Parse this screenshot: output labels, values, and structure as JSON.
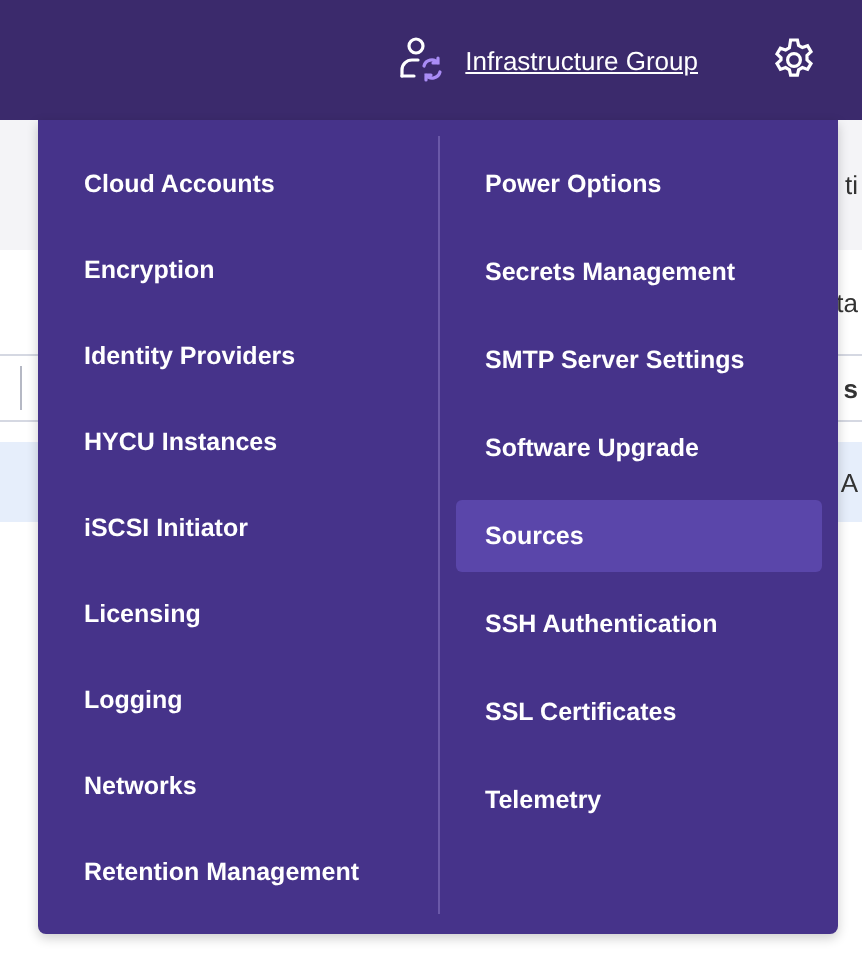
{
  "header": {
    "group_link": "Infrastructure Group"
  },
  "background": {
    "toolbar_text": "ti",
    "row_text": "ta",
    "column_header": "s",
    "selected_row_text": "A"
  },
  "settings_menu": {
    "columns": [
      [
        {
          "label": "Cloud Accounts",
          "selected": false
        },
        {
          "label": "Encryption",
          "selected": false
        },
        {
          "label": "Identity Providers",
          "selected": false
        },
        {
          "label": "HYCU Instances",
          "selected": false
        },
        {
          "label": "iSCSI Initiator",
          "selected": false
        },
        {
          "label": "Licensing",
          "selected": false
        },
        {
          "label": "Logging",
          "selected": false
        },
        {
          "label": "Networks",
          "selected": false
        },
        {
          "label": "Retention Management",
          "selected": false
        }
      ],
      [
        {
          "label": "Power Options",
          "selected": false
        },
        {
          "label": "Secrets Management",
          "selected": false
        },
        {
          "label": "SMTP Server Settings",
          "selected": false
        },
        {
          "label": "Software Upgrade",
          "selected": false
        },
        {
          "label": "Sources",
          "selected": true
        },
        {
          "label": "SSH Authentication",
          "selected": false
        },
        {
          "label": "SSL Certificates",
          "selected": false
        },
        {
          "label": "Telemetry",
          "selected": false
        }
      ]
    ]
  }
}
